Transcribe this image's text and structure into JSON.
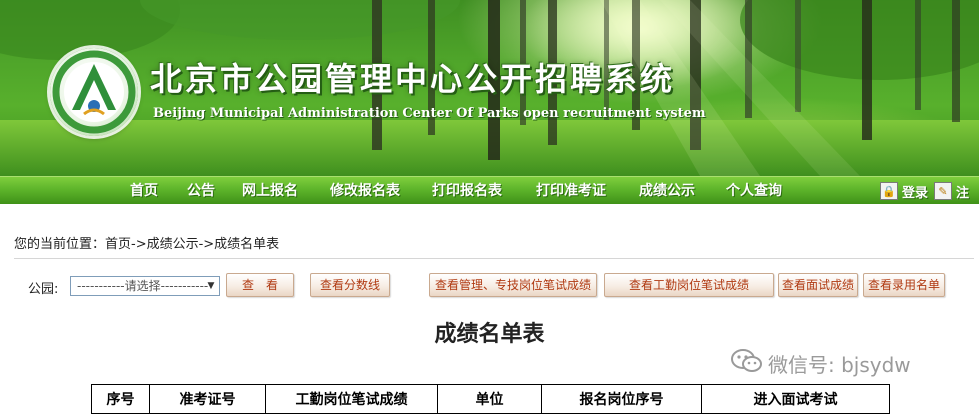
{
  "header": {
    "title": "北京市公园管理中心公开招聘系统",
    "subtitle": "Beijing Municipal Administration Center Of Parks open recruitment system"
  },
  "nav": {
    "items": [
      "首页",
      "公告",
      "网上报名",
      "修改报名表",
      "打印报名表",
      "打印准考证",
      "成绩公示",
      "个人查询"
    ],
    "login_label": "登录",
    "register_label": "注"
  },
  "breadcrumb": "您的当前位置：首页->成绩公示->成绩名单表",
  "filter": {
    "park_label": "公园:",
    "park_select_value": "-----------请选择-----------",
    "buttons": {
      "view": "查　看",
      "view_score_line": "查看分数线",
      "view_mgmt_scores": "查看管理、专技岗位笔试成绩",
      "view_worker_scores": "查看工勤岗位笔试成绩",
      "view_interview_scores": "查看面试成绩",
      "view_hired_list": "查看录用名单"
    }
  },
  "page_title": "成绩名单表",
  "watermark": "微信号: bjsydw",
  "table": {
    "headers": [
      "序号",
      "准考证号",
      "工勤岗位笔试成绩",
      "单位",
      "报名岗位序号",
      "进入面试考试"
    ]
  },
  "colors": {
    "nav_green": "#5eb52b",
    "button_text": "#b03a12",
    "banner_green": "#4fa52a"
  }
}
